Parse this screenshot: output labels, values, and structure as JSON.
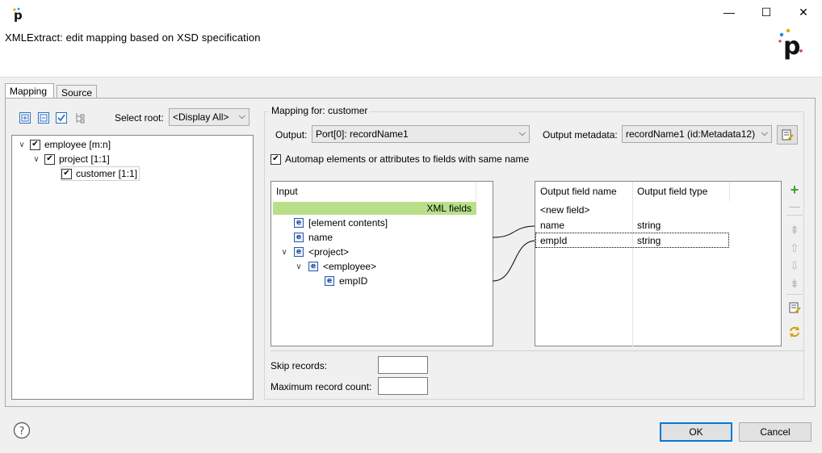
{
  "window": {
    "title": "XMLExtract: edit mapping based on XSD specification",
    "minimize": "—",
    "maximize": "☐",
    "close": "✕"
  },
  "tabs": [
    {
      "label": "Mapping"
    },
    {
      "label": "Source"
    }
  ],
  "tree_toolbar": {
    "select_root_label": "Select root:",
    "select_root_value": "<Display All>"
  },
  "tree": [
    {
      "label": "employee [m:n]",
      "checked": true
    },
    {
      "label": "project [1:1]",
      "checked": true
    },
    {
      "label": "customer [1:1]",
      "checked": true
    }
  ],
  "mapping": {
    "group_label": "Mapping for: customer",
    "output_label": "Output:",
    "output_value": "Port[0]: recordName1",
    "output_metadata_label": "Output metadata:",
    "output_metadata_value": "recordName1 (id:Metadata12)",
    "automap_label": "Automap elements or attributes to fields with same name",
    "automap_checked": true
  },
  "input_panel": {
    "header": "Input",
    "xml_fields_label": "XML fields",
    "items": [
      {
        "label": "[element contents]"
      },
      {
        "label": "name"
      },
      {
        "label": "<project>"
      },
      {
        "label": "<employee>"
      },
      {
        "label": "empID"
      }
    ]
  },
  "output_panel": {
    "headers": [
      "Output field name",
      "Output field type"
    ],
    "new_field": "<new field>",
    "rows": [
      {
        "name": "name",
        "type": "string"
      },
      {
        "name": "empId",
        "type": "string"
      }
    ]
  },
  "skip_records_label": "Skip records:",
  "skip_records_value": "",
  "max_record_count_label": "Maximum record count:",
  "max_record_count_value": "",
  "footer": {
    "ok": "OK",
    "cancel": "Cancel"
  },
  "colors": {
    "accent": "#0078d7",
    "xml_fields_green": "#b8e08a",
    "add_green": "#3aa02a"
  }
}
